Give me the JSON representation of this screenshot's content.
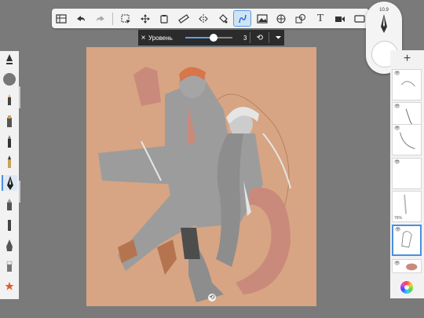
{
  "level_bar": {
    "close_icon": "×",
    "label": "Уровень",
    "value": "3",
    "slider_fraction": 0.6,
    "undo_icon": "⟲",
    "menu_icon": "⏷"
  },
  "brush": {
    "size": "10.9"
  },
  "layers": [
    {
      "visible": true,
      "opacity": ""
    },
    {
      "visible": true,
      "opacity": ""
    },
    {
      "visible": true,
      "opacity": ""
    },
    {
      "visible": true,
      "opacity": ""
    },
    {
      "visible": false,
      "opacity": "76%"
    },
    {
      "visible": true,
      "opacity": ""
    },
    {
      "visible": true,
      "opacity": ""
    }
  ],
  "toolbar": {
    "text_tool_glyph": "T",
    "add_layer_glyph": "+"
  },
  "colors": {
    "canvas": "#d7a583",
    "accent": "#4a8fe0",
    "panel": "#f2f2f2",
    "background": "#7a7a7a"
  }
}
